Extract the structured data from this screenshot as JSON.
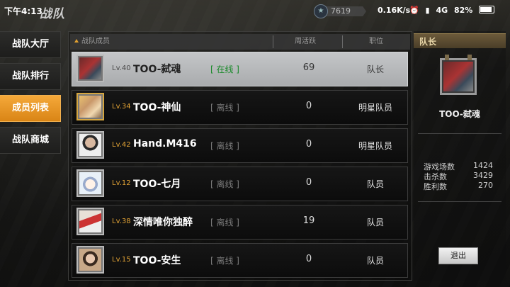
{
  "status_bar": {
    "time": "下午4:13",
    "net_speed": "0.16K/s",
    "network": "4G",
    "battery": "82%"
  },
  "header": {
    "title": "战队",
    "currency_value": "7619"
  },
  "nav": {
    "items": [
      {
        "label": "战队大厅",
        "active": false
      },
      {
        "label": "战队排行",
        "active": false
      },
      {
        "label": "成员列表",
        "active": true
      },
      {
        "label": "战队商城",
        "active": false
      }
    ]
  },
  "table": {
    "headers": {
      "members": "战队成员",
      "weekly": "周活跃",
      "role": "职位"
    },
    "rows": [
      {
        "level": "Lv.40",
        "name": "TOO-弑魂",
        "status": "[ 在线 ]",
        "weekly": "69",
        "role": "队长",
        "selected": true
      },
      {
        "level": "Lv.34",
        "name": "TOO-神仙",
        "status": "[ 离线 ]",
        "weekly": "0",
        "role": "明星队员",
        "selected": false
      },
      {
        "level": "Lv.42",
        "name": "Hand.M416",
        "status": "[ 离线 ]",
        "weekly": "0",
        "role": "明星队员",
        "selected": false
      },
      {
        "level": "Lv.12",
        "name": "TOO-七月",
        "status": "[ 离线 ]",
        "weekly": "0",
        "role": "队员",
        "selected": false
      },
      {
        "level": "Lv.38",
        "name": "深情唯你独醉",
        "status": "[ 离线 ]",
        "weekly": "19",
        "role": "队员",
        "selected": false
      },
      {
        "level": "Lv.15",
        "name": "TOO-安生",
        "status": "[ 离线 ]",
        "weekly": "0",
        "role": "队员",
        "selected": false
      }
    ]
  },
  "captain": {
    "header": "队长",
    "name": "TOO-弑魂",
    "stats": [
      {
        "label": "游戏场数",
        "value": "1424"
      },
      {
        "label": "击杀数",
        "value": "3429"
      },
      {
        "label": "胜利数",
        "value": "270"
      }
    ],
    "quit_label": "退出"
  },
  "colors": {
    "accent": "#f0a030",
    "online": "#1a8a2a",
    "level": "#e2a335"
  }
}
